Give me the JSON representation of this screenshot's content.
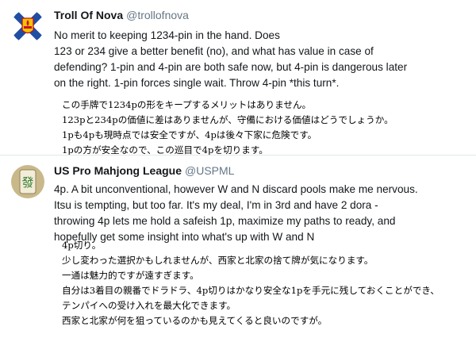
{
  "tweets": [
    {
      "display_name": "Troll Of Nova",
      "handle": "@trollofnova",
      "avatar_icon": "nova-scotia-flag-avatar",
      "english_lines": [
        "No merit to keeping 1234-pin in the hand. Does",
        "123 or 234 give a better benefit (no), and what has value in case of",
        "defending? 1-pin and 4-pin are both safe now, but 4-pin is dangerous later",
        "on the right. 1-pin forces single wait. Throw 4-pin *this turn*."
      ],
      "japanese_lines": [
        "この手牌で1234pの形をキープするメリットはありません。",
        "123pと234pの価値に差はありませんが、守備における価値はどうでしょうか。",
        "1pも4pも現時点では安全ですが、4pは後々下家に危険です。",
        "1pの方が安全なので、この巡目で4pを切ります。"
      ]
    },
    {
      "display_name": "US Pro Mahjong League",
      "handle": "@USPML",
      "avatar_icon": "mahjong-tile-avatar",
      "avatar_glyph": "發",
      "english_lines": [
        "4p.  A bit unconventional, however W and N discard pools make me nervous.",
        "Itsu is tempting, but too far.  It's my deal, I'm in 3rd and have 2 dora -",
        "throwing 4p lets me hold a safeish 1p, maximize my paths to ready, and",
        "hopefully get some insight into what's up with W and N"
      ],
      "japanese_lines": [
        "4p切り。",
        "少し変わった選択かもしれませんが、西家と北家の捨て牌が気になります。",
        "一通は魅力的ですが遠すぎます。",
        "自分は3着目の親番でドラドラ、4p切りはかなり安全な1pを手元に残しておくことができ、",
        "テンパイへの受け入れを最大化できます。",
        "西家と北家が何を狙っているのかも見えてくると良いのですが。"
      ]
    }
  ],
  "colors": {
    "name": "#14171a",
    "handle": "#657786",
    "divider": "#e1e8ed",
    "flag_blue": "#1f4ea3",
    "flag_red": "#c8102e",
    "flag_gold": "#f2c300",
    "tile_bg": "#c9b98a",
    "tile_green": "#2e7d32"
  }
}
